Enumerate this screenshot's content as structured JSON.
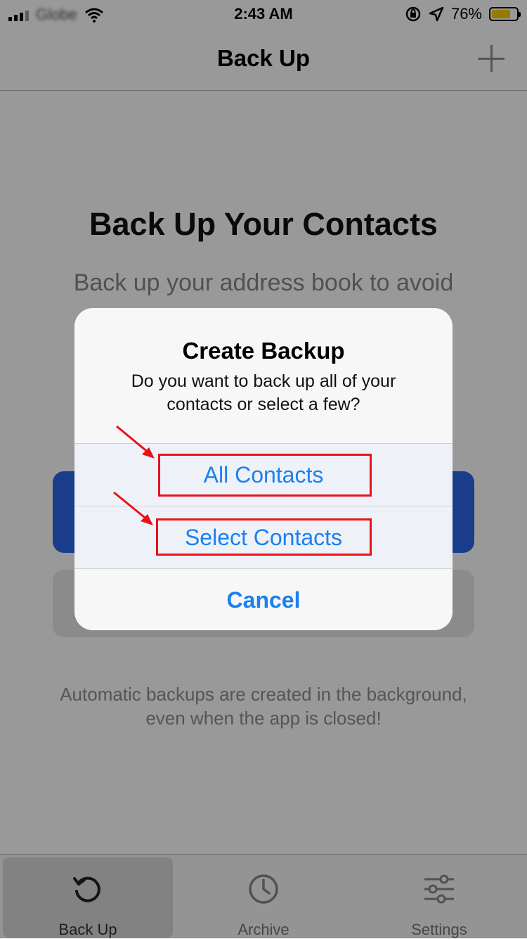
{
  "status_bar": {
    "carrier": "Globe",
    "time": "2:43 AM",
    "battery_percent": "76%",
    "battery_level": 0.76,
    "battery_color": "#ffcc00"
  },
  "nav": {
    "title": "Back Up",
    "add_icon": "plus-icon"
  },
  "content": {
    "headline": "Back Up Your Contacts",
    "description": "Back up your address book to avoid",
    "automatic_note": "Automatic backups are created in the background, even when the app is closed!"
  },
  "alert": {
    "title": "Create Backup",
    "message": "Do you want to back up all of your contacts or select a few?",
    "actions": [
      "All Contacts",
      "Select Contacts",
      "Cancel"
    ]
  },
  "tabs": [
    {
      "label": "Back Up",
      "icon": "refresh-icon",
      "selected": true
    },
    {
      "label": "Archive",
      "icon": "clock-icon",
      "selected": false
    },
    {
      "label": "Settings",
      "icon": "sliders-icon",
      "selected": false
    }
  ],
  "colors": {
    "accent": "#1a80f0",
    "primary_button": "#2a66e6",
    "annotation_red": "#e8121a"
  }
}
